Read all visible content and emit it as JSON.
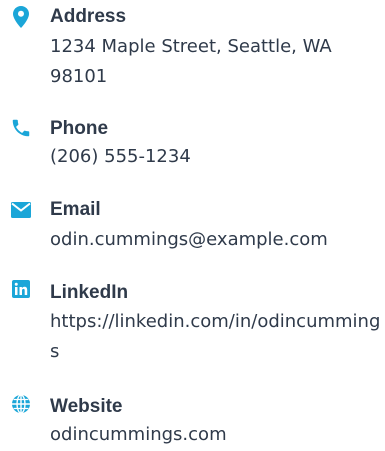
{
  "accent_color": "#1ba6d8",
  "items": [
    {
      "key": "address",
      "icon": "map-pin-icon",
      "label": "Address",
      "value": "1234 Maple Street, Seattle, WA 98101"
    },
    {
      "key": "phone",
      "icon": "phone-icon",
      "label": "Phone",
      "value": "(206) 555-1234"
    },
    {
      "key": "email",
      "icon": "envelope-icon",
      "label": "Email",
      "value": "odin.cummings@example.com"
    },
    {
      "key": "linkedin",
      "icon": "linkedin-icon",
      "label": "LinkedIn",
      "value": "https://linkedin.com/in/odincummings"
    },
    {
      "key": "website",
      "icon": "globe-icon",
      "label": "Website",
      "value": "odincummings.com"
    }
  ]
}
